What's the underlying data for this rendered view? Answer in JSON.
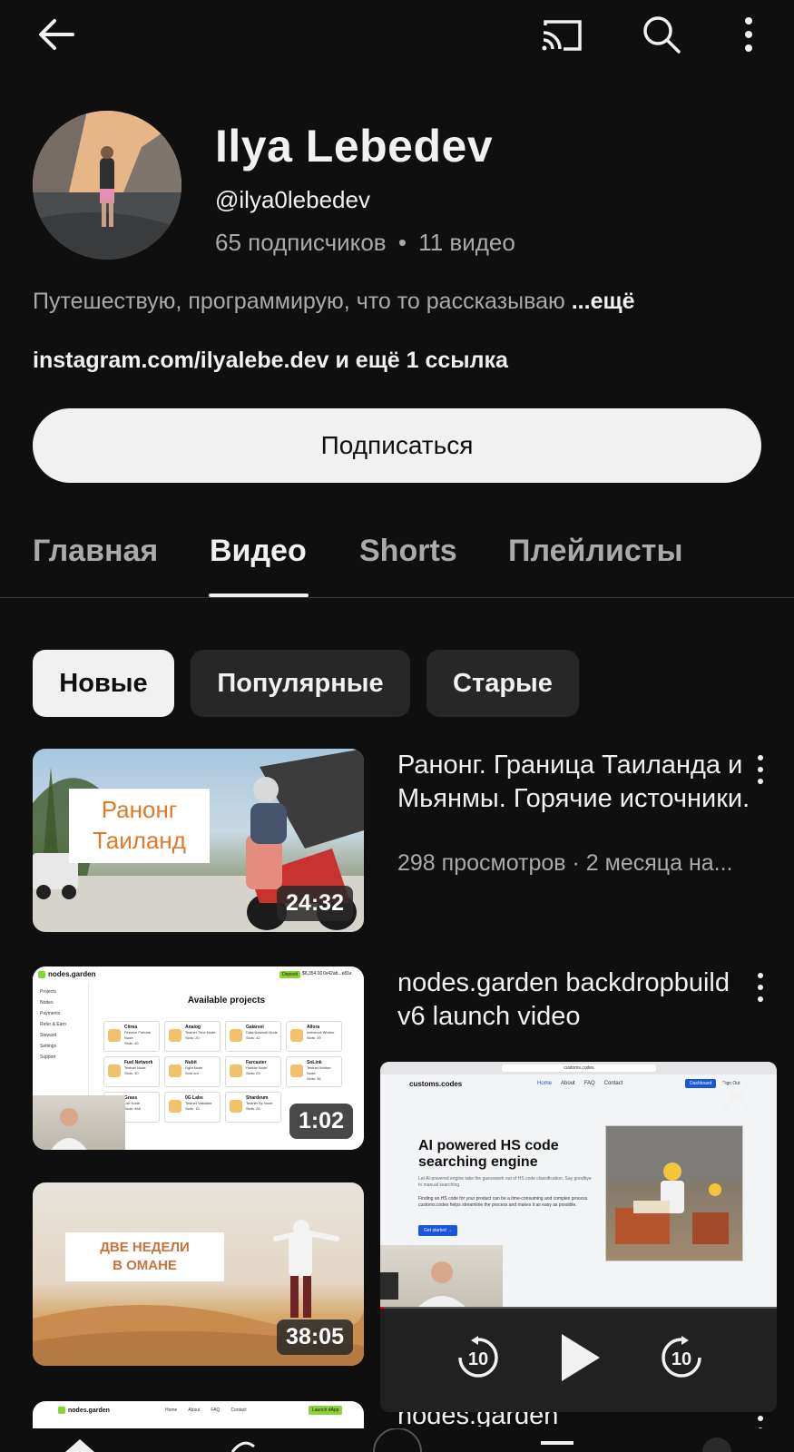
{
  "topbar": {
    "back_icon": "arrow-left-icon",
    "cast_icon": "cast-icon",
    "search_icon": "search-icon",
    "more_icon": "more-vert-icon"
  },
  "channel": {
    "name": "Ilya Lebedev",
    "handle": "@ilya0lebedev",
    "subscribers": "65 подписчиков",
    "separator": "•",
    "videos_count": "11 видео",
    "description": "Путешествую, программирую, что то рассказываю",
    "more_label": "...ещё",
    "links": "instagram.com/ilyalebe.dev и ещё 1 ссылка",
    "subscribe_label": "Подписаться"
  },
  "tabs": [
    {
      "label": "Главная"
    },
    {
      "label": "Видео",
      "active": true
    },
    {
      "label": "Shorts"
    },
    {
      "label": "Плейлисты"
    }
  ],
  "chips": [
    {
      "label": "Новые",
      "selected": true
    },
    {
      "label": "Популярные"
    },
    {
      "label": "Старые"
    }
  ],
  "videos": [
    {
      "title": "Ранонг. Граница Таиланда и Мьянмы. Горячие источники.",
      "meta": "298 просмотров · 2 месяца на...",
      "duration": "24:32",
      "thumb_text_1": "Ранонг",
      "thumb_text_2": "Таиланд"
    },
    {
      "title": "nodes.garden backdropbuild v6 launch video",
      "duration": "1:02",
      "thumb_brand": "nodes.garden",
      "thumb_heading": "Available projects",
      "thumb_menu": [
        "Projects",
        "Nodes",
        "Payments",
        "Refer & Earn",
        "Steward",
        "Settings",
        "Support"
      ],
      "thumb_badge": "Deposit",
      "thumb_balance": "$6,354.00",
      "thumb_wallet": "0x42ab...e81e",
      "thumb_projects": [
        {
          "name": "Citrea",
          "desc": "Finance Fortune Node",
          "slots": "Slots: 45"
        },
        {
          "name": "Analog",
          "desc": "Testnet Time Node",
          "slots": "Slots: 20"
        },
        {
          "name": "Galarsel",
          "desc": "Data Network Node",
          "slots": "Slots: 42"
        },
        {
          "name": "Allora",
          "desc": "Inference Worker",
          "slots": "Slots: 39"
        },
        {
          "name": "Fuel Network",
          "desc": "Testnet Node",
          "slots": "Slots: 30"
        },
        {
          "name": "Nubit",
          "desc": "Light Node",
          "slots": "Sold out"
        },
        {
          "name": "Farcaster",
          "desc": "Hubble Node",
          "slots": "Slots: 29"
        },
        {
          "name": "SoLink",
          "desc": "Testnet Worker Node",
          "slots": "Slots: 36"
        },
        {
          "name": "Grass",
          "desc": "Lite Node",
          "slots": "Slots: 458"
        },
        {
          "name": "0G Labs",
          "desc": "Testnet Validator",
          "slots": "Slots: 15"
        },
        {
          "name": "Shardeum",
          "desc": "Testnet Sp Node",
          "slots": "Slots: 26"
        }
      ]
    },
    {
      "title": "",
      "duration": "38:05",
      "thumb_text_1": "ДВЕ НЕДЕЛИ",
      "thumb_text_2": "В ОМАНЕ"
    },
    {
      "title": "nodes.garden",
      "thumb_brand": "nodes.garden",
      "thumb_nav": [
        "Home",
        "About",
        "FAQ",
        "Contact"
      ],
      "thumb_button": "Launch dApp"
    }
  ],
  "mini_player": {
    "url": "customs.codes",
    "brand": "customs.codes",
    "nav": [
      "Home",
      "About",
      "FAQ",
      "Contact"
    ],
    "nav_button": "Dashboard",
    "sign_out": "Sign Out",
    "headline": "AI powered HS code searching engine",
    "subtext": "Let AI-powered engine take the guesswork out of HS code classification. Say goodbye to manual searching.",
    "body": "Finding an HS code for your product can be a time-consuming and complex process. customs.codes helps streamline the process and makes it as easy as possible.",
    "cta": "Get started →",
    "rewind_label": "10",
    "forward_label": "10",
    "play_icon": "play-icon",
    "close_icon": "close-icon"
  },
  "colors": {
    "background": "#0f0f0f",
    "text": "#f1f1f1",
    "secondary_text": "#aaaaaa",
    "chip_bg": "#272727",
    "accent_green": "#8cd13a",
    "accent_blue": "#1a56db"
  }
}
